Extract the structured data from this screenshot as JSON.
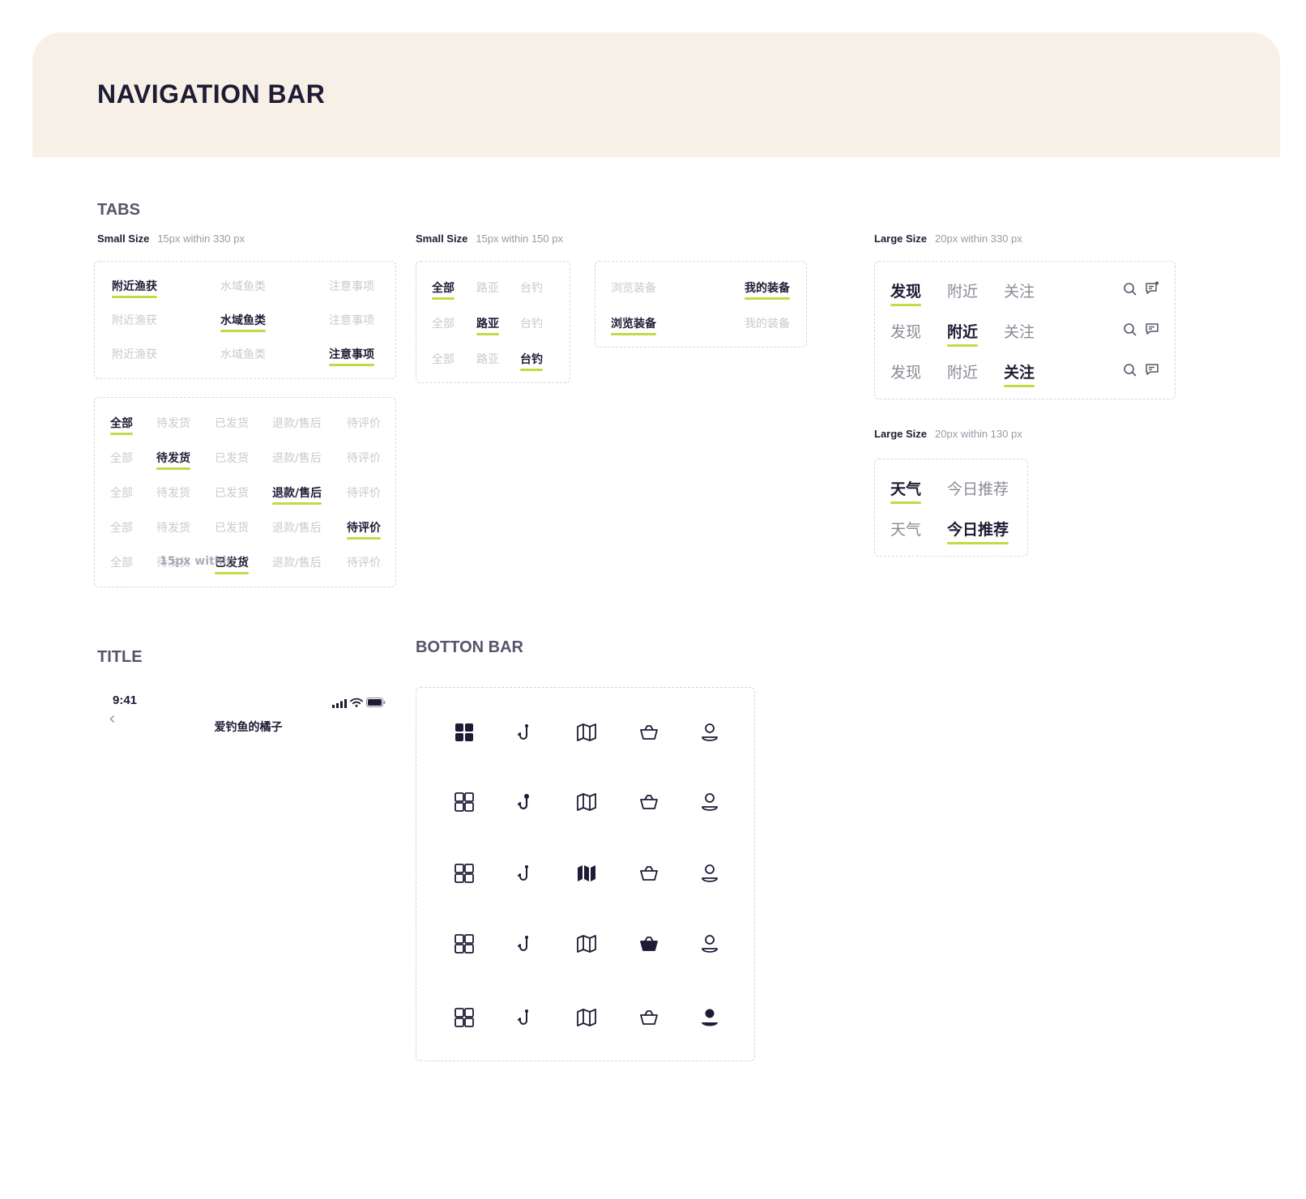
{
  "page_title": "NAVIGATION BAR",
  "tabs_section": {
    "title": "TABS",
    "small1": {
      "bold": "Small Size",
      "note": "15px within 330 px"
    },
    "small2": {
      "bold": "Small Size",
      "note": "15px within 150 px"
    },
    "large1": {
      "bold": "Large Size",
      "note": "20px within 330 px"
    },
    "large2": {
      "bold": "Large Size",
      "note": "20px within 130 px"
    },
    "group_a": {
      "labels": [
        "附近渔获",
        "水域鱼类",
        "注意事项"
      ]
    },
    "group_b": {
      "labels": [
        "全部",
        "待发货",
        "已发货",
        "退款/售后",
        "待评价"
      ],
      "overlay": "15px within"
    },
    "group_c": {
      "labels": [
        "全部",
        "路亚",
        "台钓"
      ]
    },
    "group_d": {
      "labels": [
        "浏览装备",
        "我的装备"
      ]
    },
    "group_e": {
      "labels": [
        "发现",
        "附近",
        "关注"
      ]
    },
    "group_f": {
      "labels": [
        "天气",
        "今日推荐"
      ]
    }
  },
  "title_section": {
    "title": "TITLE",
    "time": "9:41",
    "nav_title": "爱钓鱼的橘子",
    "back_glyph": "‹"
  },
  "bottom_bar_section": {
    "title": "BOTTON BAR",
    "icons": [
      "grid-icon",
      "hook-icon",
      "map-icon",
      "basket-icon",
      "user-icon"
    ]
  },
  "colors": {
    "accent": "#c5d845",
    "ink": "#1e1c35",
    "muted": "#c9c9d0",
    "header_bg": "#f7f0e6"
  }
}
